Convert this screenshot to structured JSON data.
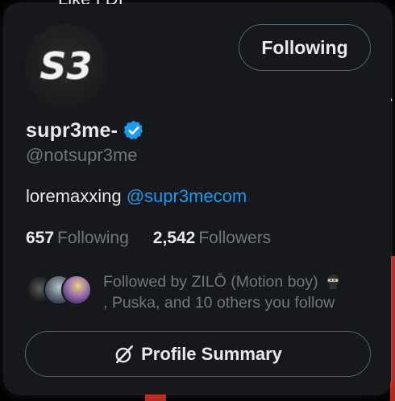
{
  "background": {
    "partial_text": "Like I DI",
    "chevron": "›"
  },
  "card": {
    "avatar_logo_text": "S3",
    "follow_button_label": "Following",
    "display_name": "supr3me-",
    "handle": "@notsupr3me",
    "bio_text": "loremaxxing ",
    "bio_mention": "@supr3mecom",
    "stats": {
      "following_count": "657",
      "following_label": "Following",
      "followers_count": "2,542",
      "followers_label": "Followers"
    },
    "followed_by": {
      "prefix": "Followed by ",
      "name": "ZILŌ (Motion boy)",
      "rest": ", Puska, and 10 others you follow"
    },
    "profile_summary_label": "Profile Summary"
  },
  "colors": {
    "card_bg": "#16181c",
    "text_primary": "#e7e9ea",
    "text_secondary": "#71767b",
    "accent_blue": "#1d9bf0",
    "border": "#536471"
  },
  "icons": [
    "verified-badge-icon",
    "ninja-emoji-icon",
    "grok-icon"
  ]
}
